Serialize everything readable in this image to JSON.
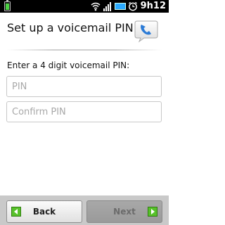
{
  "status_bar": {
    "time": "9h12",
    "icons": [
      "battery-icon",
      "wifi-icon",
      "signal-icon",
      "battery-blue-icon",
      "alarm-icon"
    ]
  },
  "header": {
    "title": "Set up a voicemail PIN",
    "icon": "voicemail-phone-icon"
  },
  "form": {
    "instruction": "Enter a 4 digit voicemail PIN:",
    "pin_placeholder": "PIN",
    "confirm_placeholder": "Confirm PIN"
  },
  "footer": {
    "back_label": "Back",
    "next_label": "Next"
  },
  "colors": {
    "accent_green": "#57c12a",
    "bottom_bar": "#c9c9c9"
  }
}
